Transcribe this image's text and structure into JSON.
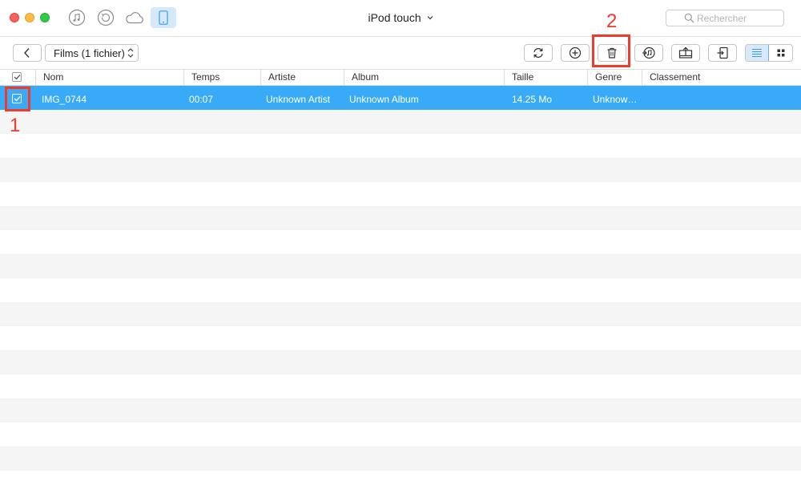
{
  "window": {
    "title": "iPod touch",
    "title_chevron": "⌄",
    "search_placeholder": "Rechercher"
  },
  "toolbar": {
    "category_select": "Films (1 fichier)",
    "buttons": [
      "refresh-icon",
      "add-icon",
      "trash-icon",
      "itunes-export-icon",
      "export-to-computer-icon",
      "send-to-device-icon"
    ],
    "view_modes": [
      {
        "name": "list-view-icon",
        "active": true
      },
      {
        "name": "grid-view-icon",
        "active": false
      }
    ]
  },
  "table": {
    "columns": [
      "Nom",
      "Temps",
      "Artiste",
      "Album",
      "Taille",
      "Genre",
      "Classement"
    ],
    "header_checkbox_checked": true,
    "rows": [
      {
        "checked": true,
        "selected": true,
        "name": "IMG_0744",
        "time": "00:07",
        "artist": "Unknown Artist",
        "album": "Unknown Album",
        "size": "14.25 Mo",
        "genre": "Unknow…",
        "rating": ""
      }
    ]
  },
  "annotations": [
    {
      "label": "1",
      "target": "row checkbox"
    },
    {
      "label": "2",
      "target": "delete button"
    }
  ],
  "colors": {
    "selection": "#39aaf7",
    "annotation": "#f03a2a",
    "active_tab": "#d6e9fb"
  }
}
